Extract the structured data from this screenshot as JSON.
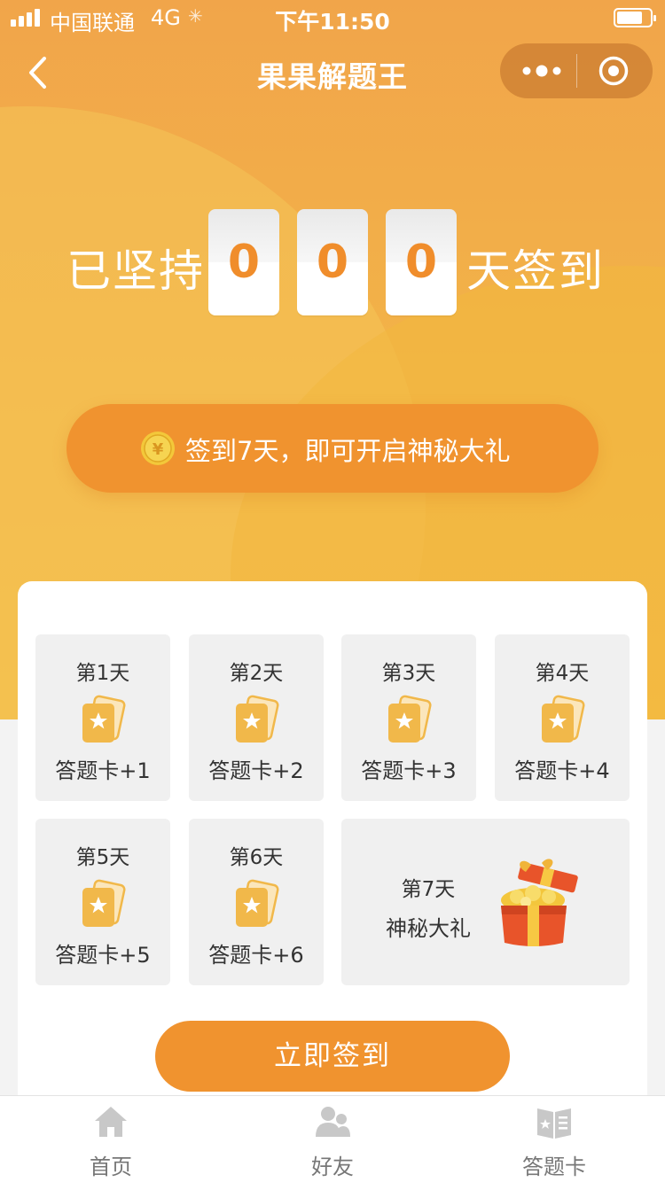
{
  "status_bar": {
    "carrier": "中国联通",
    "network": "4G",
    "time": "下午11:50"
  },
  "nav": {
    "title": "果果解题王"
  },
  "checkin": {
    "prefix": "已坚持",
    "digits": [
      "0",
      "0",
      "0"
    ],
    "suffix": "天签到"
  },
  "tip": {
    "text": "签到7天，即可开启神秘大礼"
  },
  "days": [
    {
      "label": "第1天",
      "reward": "答题卡+1"
    },
    {
      "label": "第2天",
      "reward": "答题卡+2"
    },
    {
      "label": "第3天",
      "reward": "答题卡+3"
    },
    {
      "label": "第4天",
      "reward": "答题卡+4"
    },
    {
      "label": "第5天",
      "reward": "答题卡+5"
    },
    {
      "label": "第6天",
      "reward": "答题卡+6"
    },
    {
      "label": "第7天",
      "reward": "神秘大礼"
    }
  ],
  "signin_button": "立即签到",
  "tabs": [
    {
      "label": "首页",
      "icon": "home-icon"
    },
    {
      "label": "好友",
      "icon": "friends-icon"
    },
    {
      "label": "答题卡",
      "icon": "answer-card-icon"
    }
  ],
  "colors": {
    "accent": "#f0932f",
    "hero_top": "#f1a54a",
    "hero_bottom": "#f4bd45",
    "card_icon": "#f1b84a",
    "tab_icon": "#c8c8c8"
  }
}
